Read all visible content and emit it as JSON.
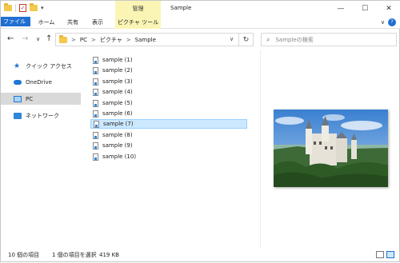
{
  "window": {
    "title": "Sample",
    "context_group": "管理",
    "controls": [
      "—",
      "☐",
      "✕"
    ]
  },
  "ribbon": {
    "tabs": [
      "ファイル",
      "ホーム",
      "共有",
      "表示",
      "ピクチャ ツール"
    ],
    "collapse": "∨",
    "help": "?"
  },
  "nav": {
    "back": "←",
    "forward": "→",
    "recent": "∨",
    "up": "↑"
  },
  "address": {
    "crumbs": [
      "PC",
      "ピクチャ",
      "Sample"
    ],
    "separator": ">",
    "dropdown": "∨",
    "refresh": "↻"
  },
  "search": {
    "placeholder": "Sampleの検索"
  },
  "sidebar": {
    "items": [
      {
        "label": "クイック アクセス",
        "icon": "star-icon"
      },
      {
        "label": "OneDrive",
        "icon": "cloud-icon"
      },
      {
        "label": "PC",
        "icon": "monitor-icon",
        "selected": true
      },
      {
        "label": "ネットワーク",
        "icon": "network-icon"
      }
    ]
  },
  "files": [
    {
      "name": "sample (1)"
    },
    {
      "name": "sample (2)"
    },
    {
      "name": "sample (3)"
    },
    {
      "name": "sample (4)"
    },
    {
      "name": "sample (5)"
    },
    {
      "name": "sample (6)"
    },
    {
      "name": "sample (7)",
      "selected": true
    },
    {
      "name": "sample (8)"
    },
    {
      "name": "sample (9)"
    },
    {
      "name": "sample (10)"
    }
  ],
  "status": {
    "item_count": "10 個の項目",
    "selected": "1 個の項目を選択",
    "size": "419 KB"
  },
  "colors": {
    "accent": "#1f6fd1",
    "context_tab": "#fbf5b5",
    "selection": "#cce8ff"
  }
}
